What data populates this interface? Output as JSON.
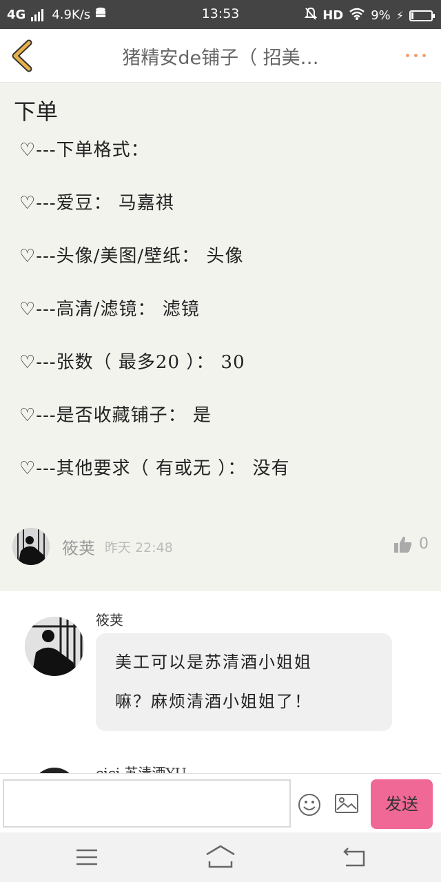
{
  "status_bar": {
    "network": "4G",
    "speed": "4.9K/s",
    "time": "13:53",
    "hd": "HD",
    "battery": "9%",
    "battery_fraction": 0.09
  },
  "header": {
    "title": "猪精安de铺子（ 招美…",
    "back_icon": "chevron-left-icon",
    "more_icon": "more-dots-icon"
  },
  "post": {
    "title": "下单",
    "lines": [
      "♡---下单格式：",
      "♡---爱豆： 马嘉祺",
      "♡---头像/美图/壁纸： 头像",
      "♡---高清/滤镜： 滤镜",
      "♡---张数（ 最多20 ）： 30",
      "♡---是否收藏铺子： 是",
      "♡---其他要求（ 有或无 ）： 没有"
    ],
    "author": "筱荚",
    "time": "昨天 22:48",
    "likes": "0"
  },
  "comments": [
    {
      "name": "筱荚",
      "text_line1": "美工可以是苏清酒小姐姐",
      "text_line2": "嘛？麻烦清酒小姐姐了！"
    },
    {
      "name": "cici 苏清酒YU"
    }
  ],
  "input": {
    "value": "",
    "placeholder": "",
    "send_label": "发送"
  },
  "colors": {
    "accent": "#f06896",
    "back_icon": "#e8b04a",
    "more_dots": "#f0a070"
  }
}
